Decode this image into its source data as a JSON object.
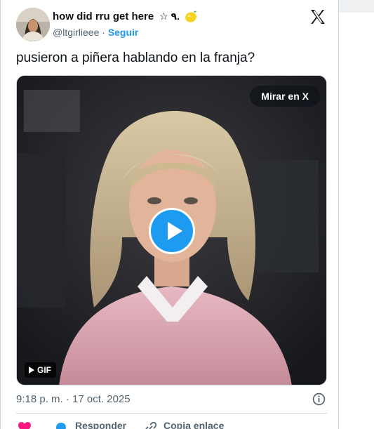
{
  "author": {
    "display_name": "how did rru get here",
    "name_extra": "☆ ۹.",
    "handle": "@ltgirlieee",
    "separator": "·",
    "follow_label": "Seguir"
  },
  "tweet": {
    "text": "pusieron a piñera hablando en la franja?",
    "timestamp": "9:18 p. m. · 17 oct. 2025"
  },
  "media": {
    "view_on_x_label": "Mirar en X",
    "gif_label": "GIF"
  },
  "actions": {
    "reply_label": "Responder",
    "copy_link_label": "Copia enlace"
  },
  "colors": {
    "accent": "#1d9bf0",
    "like": "#f91880",
    "text_secondary": "#536471",
    "border": "#cfd9de"
  },
  "icons": [
    "x-logo-icon",
    "lemon-emoji-icon",
    "play-icon",
    "gif-play-icon",
    "info-icon",
    "heart-icon",
    "reply-icon",
    "link-icon"
  ]
}
